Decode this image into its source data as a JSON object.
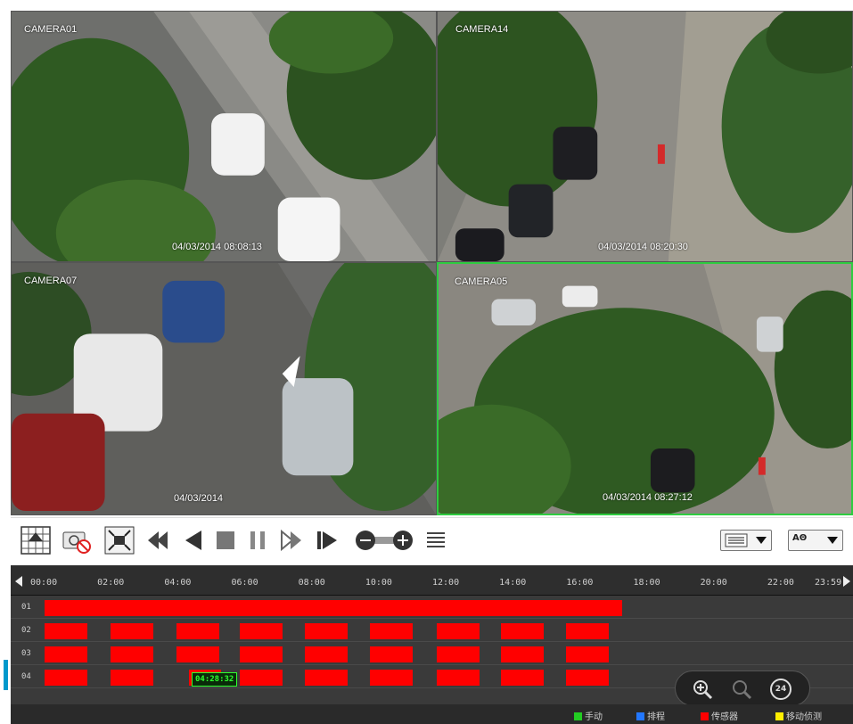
{
  "cameras": [
    {
      "name": "CAMERA01",
      "timestamp": "04/03/2014  08:08:13"
    },
    {
      "name": "CAMERA14",
      "timestamp": "04/03/2014  08:20:30"
    },
    {
      "name": "CAMERA07",
      "timestamp": "04/03/2014"
    },
    {
      "name": "CAMERA05",
      "timestamp": "04/03/2014  08:27:12"
    }
  ],
  "toolbar": {
    "buttons": [
      "layout-grid-icon",
      "snapshot-disable-icon",
      "fullscreen-icon",
      "rewind-icon",
      "step-back-icon",
      "stop-icon",
      "pause-icon",
      "fast-forward-icon",
      "step-forward-icon",
      "speed-slider-icon",
      "list-icon"
    ],
    "dropdown1_icon": "list-menu-icon",
    "dropdown2_label": "AΘ"
  },
  "timeline": {
    "hours": [
      "00:00",
      "02:00",
      "04:00",
      "06:00",
      "08:00",
      "10:00",
      "12:00",
      "14:00",
      "16:00",
      "18:00",
      "20:00",
      "22:00",
      "23:59"
    ],
    "channels": [
      "01",
      "02",
      "03",
      "04"
    ],
    "cursor_time": "04:28:32",
    "record_color": "#ff0000"
  },
  "legend": [
    {
      "label": "手动",
      "color": "#22cc22"
    },
    {
      "label": "排程",
      "color": "#2277ff"
    },
    {
      "label": "传感器",
      "color": "#ff0000"
    },
    {
      "label": "移动侦测",
      "color": "#ffee00"
    }
  ],
  "zoom": {
    "badge": "24"
  }
}
